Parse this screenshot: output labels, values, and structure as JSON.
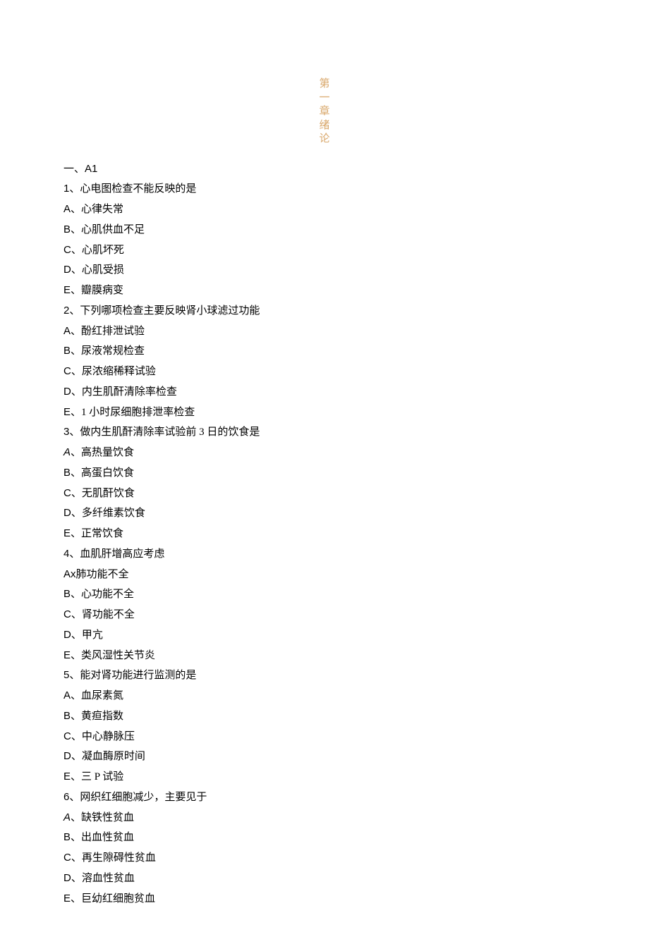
{
  "chapter_title": {
    "l1": "第",
    "l2": "一",
    "l3": "章",
    "l4": "绪",
    "l5": "论"
  },
  "section_label_prefix": "一、",
  "section_label_code": "A1",
  "questions": [
    {
      "num": "1",
      "text": "、心电图检查不能反映的是",
      "options": [
        {
          "letter": "A",
          "text": "、心律失常"
        },
        {
          "letter": "B",
          "text": "、心肌供血不足"
        },
        {
          "letter": "C",
          "text": "、心肌坏死"
        },
        {
          "letter": "D",
          "text": "、心肌受损"
        },
        {
          "letter": "E",
          "text": "、瓣膜病变"
        }
      ]
    },
    {
      "num": "2",
      "text": "、下列哪项检查主要反映肾小球滤过功能",
      "options": [
        {
          "letter": "A",
          "text": "、酚红排泄试验"
        },
        {
          "letter": "B",
          "text": "、尿液常规检查"
        },
        {
          "letter": "C",
          "text": "、尿浓缩稀释试验"
        },
        {
          "letter": "D",
          "text": "、内生肌酐清除率检查"
        },
        {
          "letter": "E",
          "text": "、1 小时尿细胞排泄率检查"
        }
      ]
    },
    {
      "num": "3",
      "text": "、做内生肌酐清除率试验前 3 日的饮食是",
      "options": [
        {
          "letter": "A",
          "italic": true,
          "text": "、高热量饮食"
        },
        {
          "letter": "B",
          "text": "、高蛋白饮食"
        },
        {
          "letter": "C",
          "text": "、无肌酐饮食"
        },
        {
          "letter": "D",
          "text": "、多纤维素饮食"
        },
        {
          "letter": "E",
          "text": "、正常饮食"
        }
      ]
    },
    {
      "num": "4",
      "text": "、血肌肝增高应考虑",
      "options": [
        {
          "letter": "Ax",
          "text": "肺功能不全"
        },
        {
          "letter": "B",
          "text": "、心功能不全"
        },
        {
          "letter": "C",
          "text": "、肾功能不全"
        },
        {
          "letter": "D",
          "text": "、甲亢"
        },
        {
          "letter": "E",
          "text": "、类风湿性关节炎"
        }
      ]
    },
    {
      "num": "5",
      "text": "、能对肾功能进行监测的是",
      "options": [
        {
          "letter": "A",
          "text": "、血尿素氮"
        },
        {
          "letter": "B",
          "text": "、黄疸指数"
        },
        {
          "letter": "C",
          "text": "、中心静脉压"
        },
        {
          "letter": "D",
          "text": "、凝血酶原时间"
        },
        {
          "letter": "E",
          "text": "、三 P 试验"
        }
      ]
    },
    {
      "num": "6",
      "text": "、网织红细胞减少，主要见于",
      "options": [
        {
          "letter": "A",
          "italic": true,
          "text": "、缺铁性贫血"
        },
        {
          "letter": "B",
          "text": "、出血性贫血"
        },
        {
          "letter": "C",
          "text": "、再生隙碍性贫血"
        },
        {
          "letter": "D",
          "text": "、溶血性贫血"
        },
        {
          "letter": "E",
          "text": "、巨幼红细胞贫血"
        }
      ]
    }
  ]
}
